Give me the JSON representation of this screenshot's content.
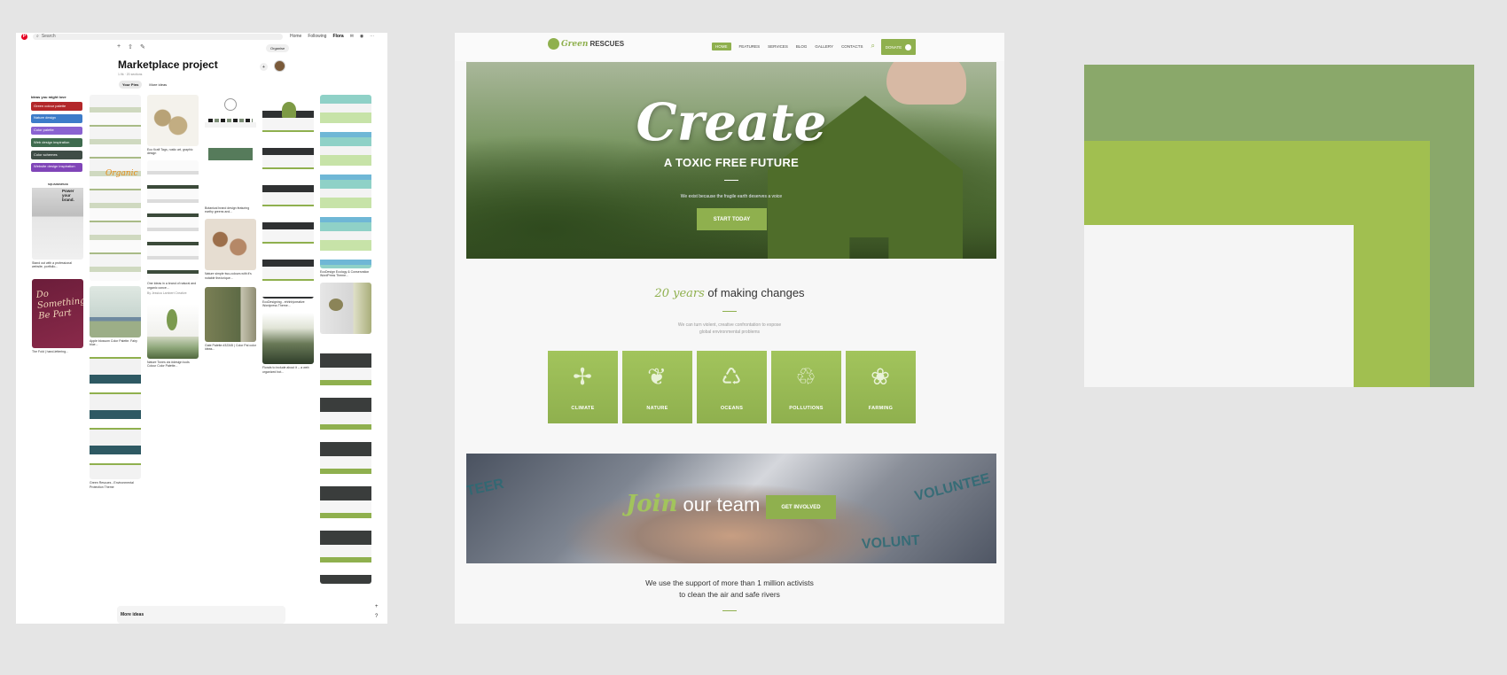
{
  "pinterest": {
    "search_placeholder": "Search",
    "nav": [
      "Home",
      "Following",
      "Flora"
    ],
    "organise": "Organise",
    "board_title": "Marketplace project",
    "board_meta": "1.9k · 20 sections",
    "tabs": [
      "Your Pins",
      "More ideas"
    ],
    "ideas_label": "Ideas you might love",
    "chips": [
      {
        "label": "Green colour palette",
        "color": "#b3272a"
      },
      {
        "label": "Nature design",
        "color": "#3d7cc9"
      },
      {
        "label": "Color palette",
        "color": "#8a62d1"
      },
      {
        "label": "Web design inspiration",
        "color": "#3e6b4e"
      },
      {
        "label": "Color schemes",
        "color": "#3f4d46"
      },
      {
        "label": "Website design inspiration",
        "color": "#8045b8"
      }
    ],
    "captions": {
      "squarespace": "SQUARESPACE",
      "power": "Power your brand.",
      "stand_out": "Stand out with a professional website, portfolio...",
      "fold": "The Fold | hand-lettering...",
      "eco_tags": "Eco Kraft Tags, rustic art, graphic design",
      "apple_blossom": "Apple blossom Color Palette. Fairy blue...",
      "one_idea": "One Ideas in a brand of natural and organic conce...",
      "one_idea_by": "By Jessica Lambert Creative",
      "nature_tone": "Nature Tones via #design tools Colour Color Palette...",
      "botanical": "Botanical brand design featuring earthy greens and...",
      "nature_simple": "Nature simple two-colours with it's notable the/unique...",
      "gate": "Gate Palette #32345 | Color Pal color ideas...",
      "ecodesigns": "EcoDesigning - ehhhh|creative Wordpress Theme...",
      "ecodesign2": "EcoDesign Ecology & Conservation WordPress Theme...",
      "green_rescues": "Green Rescues - Environmental Protection Theme",
      "travel": "Florals to include about it -- a web organized bot..."
    },
    "more_ideas": "More ideas",
    "float_buttons": [
      "+",
      "?"
    ]
  },
  "site": {
    "logo_green": "Green",
    "logo_dark": "RESCUES",
    "menu": [
      "HOME",
      "FEATURES",
      "SERVICES",
      "BLOG",
      "GALLERY",
      "CONTACTS"
    ],
    "donate": "DONATE",
    "hero_script": "Create",
    "hero_heading": "A TOXIC FREE FUTURE",
    "hero_small": "We exist because the fragile earth deserves a voice",
    "hero_button": "START TODAY",
    "years_script": "20 years",
    "years_rest": " of making changes",
    "years_desc_1": "We can turn violent, creative confrontation to expose",
    "years_desc_2": "global environmental problems",
    "cards": [
      {
        "label": "CLIMATE",
        "icon": "wind-turbine-icon",
        "glyph": "✢"
      },
      {
        "label": "NATURE",
        "icon": "leaf-icon",
        "glyph": "❦"
      },
      {
        "label": "OCEANS",
        "icon": "water-drop-icon",
        "glyph": "♺"
      },
      {
        "label": "POLLUTIONS",
        "icon": "recycle-bag-icon",
        "glyph": "♲"
      },
      {
        "label": "FARMING",
        "icon": "apple-icon",
        "glyph": "❀"
      }
    ],
    "join_script": "Join",
    "join_rest": " our team",
    "join_button": "GET INVOLVED",
    "volunteer_words": [
      "TEER",
      "VOLUNTEE",
      "VOLUNT"
    ],
    "support_1": "We use the support of more than 1 million activists",
    "support_2": "to clean the air and safe rivers"
  },
  "swatch": {
    "colors": [
      "#8aa86a",
      "#a1bf50",
      "#f5f5f5"
    ]
  },
  "accent": "#8fb04e"
}
